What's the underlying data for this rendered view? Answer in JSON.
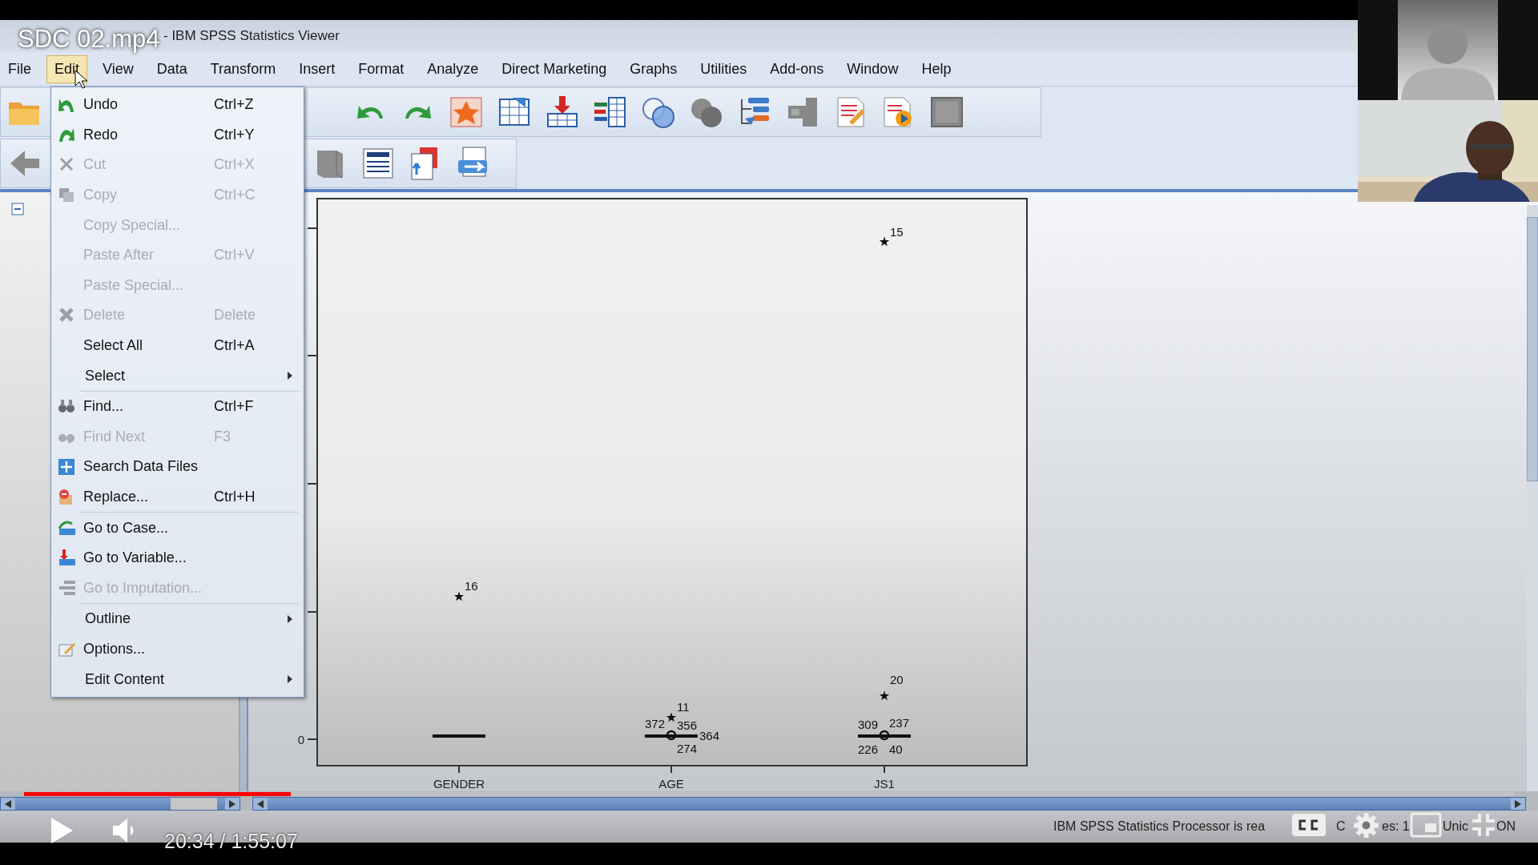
{
  "video": {
    "title": "SDC 02.mp4",
    "time": "20:34 / 1:55:07",
    "playing": false,
    "progress": {
      "level": 0.179
    }
  },
  "window": {
    "title": "- IBM SPSS Statistics Viewer"
  },
  "menu_bar": [
    {
      "label": "File",
      "selected": false
    },
    {
      "label": "Edit",
      "selected": true
    },
    {
      "label": "View",
      "selected": false
    },
    {
      "label": "Data",
      "selected": false
    },
    {
      "label": "Transform",
      "selected": false
    },
    {
      "label": "Insert",
      "selected": false
    },
    {
      "label": "Format",
      "selected": false
    },
    {
      "label": "Analyze",
      "selected": false
    },
    {
      "label": "Direct Marketing",
      "selected": false
    },
    {
      "label": "Graphs",
      "selected": false
    },
    {
      "label": "Utilities",
      "selected": false
    },
    {
      "label": "Add-ons",
      "selected": false
    },
    {
      "label": "Window",
      "selected": false
    },
    {
      "label": "Help",
      "selected": false
    }
  ],
  "edit_menu": {
    "items": [
      {
        "label": "Undo",
        "shortcut": "Ctrl+Z",
        "disabled": false
      },
      {
        "label": "Redo",
        "shortcut": "Ctrl+Y",
        "disabled": false
      },
      {
        "label": "Cut",
        "shortcut": "Ctrl+X",
        "disabled": true
      },
      {
        "label": "Copy",
        "shortcut": "Ctrl+C",
        "disabled": true
      },
      {
        "label": "Copy Special...",
        "disabled": true
      },
      {
        "label": "Paste After",
        "shortcut": "Ctrl+V",
        "disabled": true
      },
      {
        "label": "Paste Special...",
        "disabled": true
      },
      {
        "label": "Delete",
        "shortcut": "Delete",
        "disabled": true
      },
      {
        "label": "Select All",
        "shortcut": "Ctrl+A",
        "disabled": false
      },
      {
        "label": "Select",
        "disabled": false,
        "submenu": true
      },
      {
        "label": "Find...",
        "shortcut": "Ctrl+F",
        "disabled": false,
        "separator_before": true
      },
      {
        "label": "Find Next",
        "shortcut": "F3",
        "disabled": true
      },
      {
        "label": "Search Data Files",
        "disabled": false
      },
      {
        "label": "Replace...",
        "shortcut": "Ctrl+H",
        "disabled": false
      },
      {
        "label": "Go to Case...",
        "disabled": false,
        "separator_before": true
      },
      {
        "label": "Go to Variable...",
        "disabled": false
      },
      {
        "label": "Go to Imputation...",
        "disabled": true
      },
      {
        "label": "Outline",
        "disabled": false,
        "submenu": true,
        "separator_before": true
      },
      {
        "label": "Options...",
        "disabled": false
      },
      {
        "label": "Edit Content",
        "disabled": false,
        "submenu": true
      }
    ]
  },
  "chart": {
    "y_tick": "0",
    "categories": [
      "GENDER",
      "AGE",
      "JS1"
    ],
    "points": [
      {
        "kind": "extreme",
        "labels": [
          "16"
        ]
      },
      {
        "kind": "extreme",
        "labels": [
          "15"
        ]
      },
      {
        "kind": "extreme",
        "labels": [
          "20"
        ]
      },
      {
        "kind": "extreme",
        "labels": [
          "11"
        ]
      },
      {
        "kind": "outlier",
        "labels": [
          "372",
          "356",
          "364",
          "274"
        ]
      },
      {
        "kind": "outlier",
        "labels": [
          "309",
          "237",
          "226",
          "40"
        ]
      }
    ]
  },
  "status_bar": [
    "IBM SPSS Statistics Processor is rea",
    "C",
    "es: 1",
    "Unic",
    "ON"
  ]
}
